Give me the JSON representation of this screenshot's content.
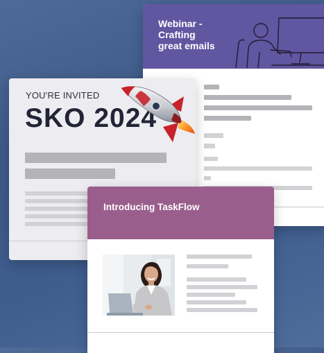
{
  "webinar_card": {
    "title": "Webinar -\nCrafting\ngreat emails",
    "header_color": "#6156a0",
    "illustration": "person-at-computer-icon"
  },
  "sko_card": {
    "invited_text": "YOU'RE INVITED",
    "headline": "SKO 2024",
    "decoration": "rocket-icon"
  },
  "taskflow_card": {
    "title": "Introducing TaskFlow",
    "header_color": "#9a5e8d",
    "photo": "woman-with-laptop-photo"
  }
}
